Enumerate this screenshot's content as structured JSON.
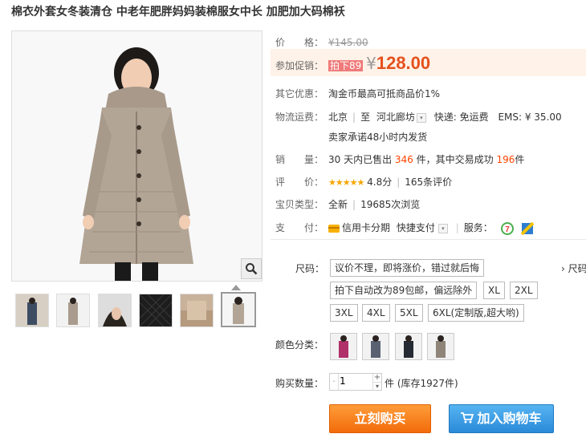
{
  "title": "棉衣外套女冬装清仓 中老年肥胖妈妈装棉服女中长 加肥加大码棉袄",
  "price": {
    "label": "价　　格：",
    "currency": "¥",
    "original": "145.00"
  },
  "promo": {
    "label": "参加促销：",
    "tag": "拍下89",
    "currency": "¥",
    "value": "128.00"
  },
  "other_offer": {
    "label": "其它优惠：",
    "text": "淘金币最高可抵商品价1%"
  },
  "shipping": {
    "label": "物流运费：",
    "from": "北京",
    "to_label": "至",
    "to": "河北廊坊",
    "express": "快递: 免运费",
    "ems": "EMS: ¥ 35.00",
    "promise": "卖家承诺48小时内发货"
  },
  "sales": {
    "label": "销　　量：",
    "prefix": "30 天内已售出",
    "count": "346",
    "mid": "件，其中交易成功",
    "success": "196",
    "suffix": "件"
  },
  "rating": {
    "label": "评　　价：",
    "stars": "★★★★★",
    "score": "4.8分",
    "reviews": "165条评价"
  },
  "type": {
    "label": "宝贝类型：",
    "condition": "全新",
    "views": "19685次浏览"
  },
  "payment": {
    "label": "支　　付：",
    "credit": "信用卡分期",
    "quick": "快捷支付",
    "service_label": "服务："
  },
  "size": {
    "label": "尺码：",
    "side_link": "› 尺码",
    "options": [
      "议价不理，即将涨价，错过就后悔",
      "拍下自动改为89包邮，偏远除外",
      "XL",
      "2XL",
      "3XL",
      "4XL",
      "5XL",
      "6XL(定制版,超大哟)"
    ]
  },
  "color": {
    "label": "颜色分类：",
    "swatches": [
      "#b0306a",
      "#5a6272",
      "#262a32",
      "#8e8478"
    ]
  },
  "quantity": {
    "label": "购买数量：",
    "value": "1",
    "stock": "件 (库存1927件)",
    "dec": "-",
    "inc": "+",
    "down": "▾"
  },
  "buttons": {
    "buy": "立刻购买",
    "cart": "加入购物车"
  },
  "colors": {
    "accent": "#e5511d",
    "buy": "#f26b0a",
    "cart": "#2a8ad8"
  }
}
